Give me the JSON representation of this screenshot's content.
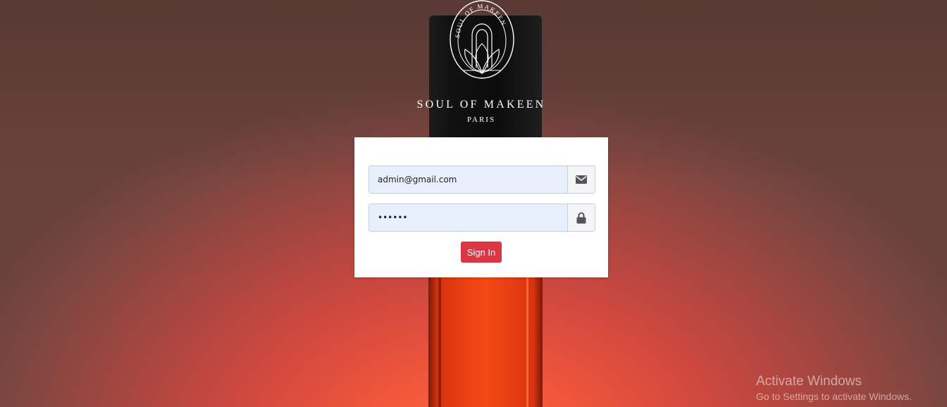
{
  "brand": {
    "logo_text": "SOUL OF MAKEEN",
    "name": "SOUL OF MAKEEN",
    "city": "PARIS"
  },
  "login": {
    "email_value": "admin@gmail.com",
    "password_value": "••••••",
    "email_icon": "envelope-icon",
    "password_icon": "lock-icon",
    "submit_label": "Sign In"
  },
  "windows_watermark": {
    "title": "Activate Windows",
    "subtitle": "Go to Settings to activate Windows."
  },
  "colors": {
    "accent": "#dc3545",
    "input_autofill_bg": "#e8f0fe",
    "card_bg": "#ffffff"
  }
}
